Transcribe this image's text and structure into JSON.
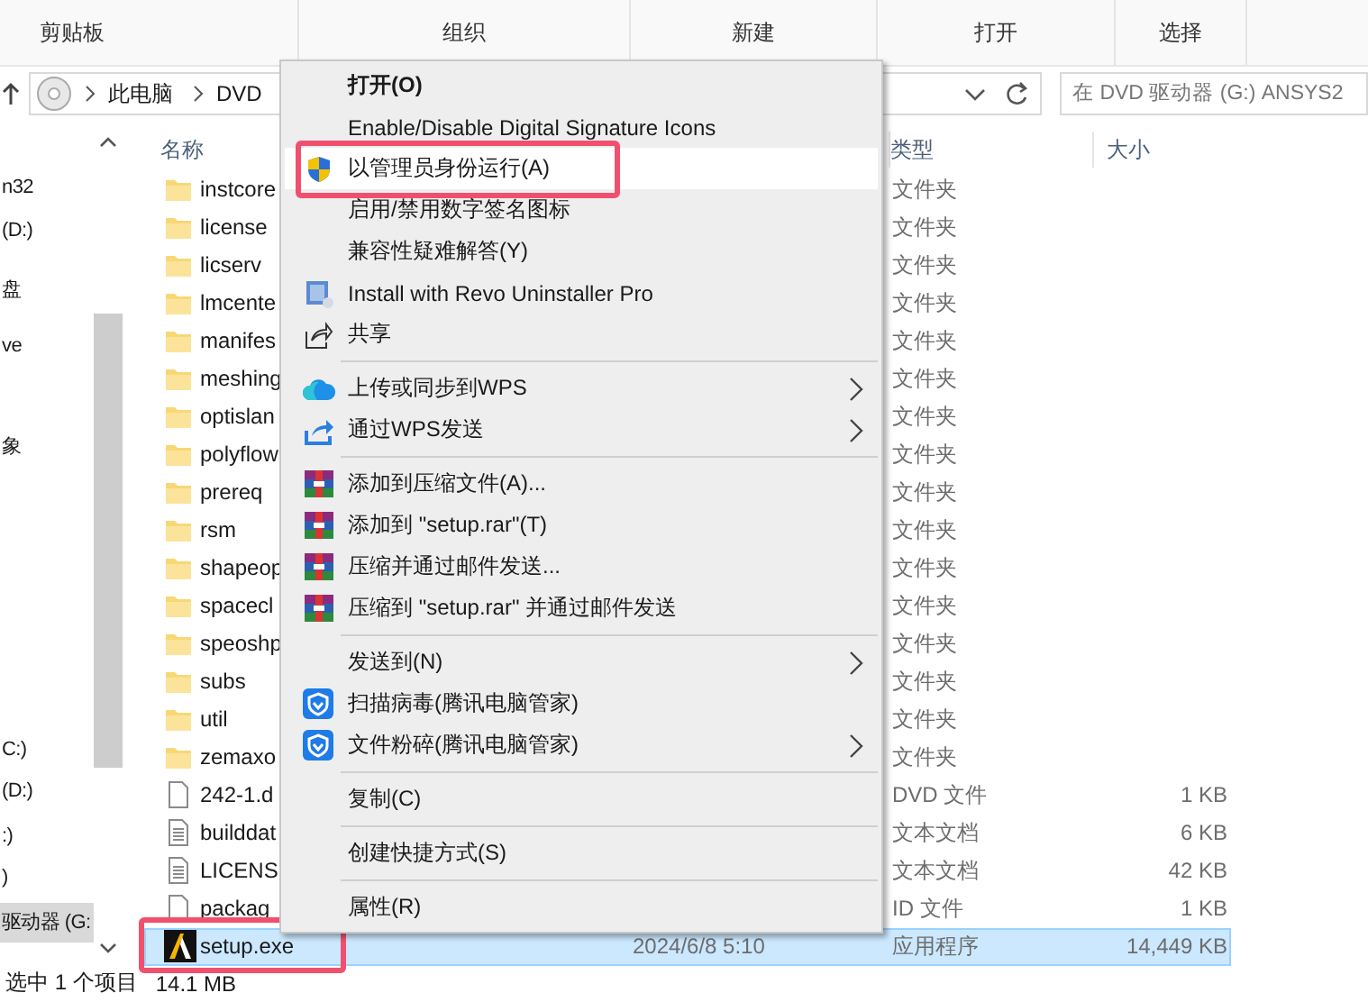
{
  "ribbon": {
    "groups": [
      "剪贴板",
      "组织",
      "新建",
      "打开",
      "选择"
    ]
  },
  "address": {
    "path": [
      "此电脑",
      "DVD"
    ],
    "search": {
      "placeholder": "在 DVD 驱动器 (G:) ANSYS2"
    }
  },
  "nav": {
    "items": [
      {
        "label": "n32",
        "selected": false
      },
      {
        "label": "(D:)",
        "selected": false
      },
      {
        "label": "盘",
        "selected": false
      },
      {
        "label": "ve",
        "selected": false
      },
      {
        "label": "象",
        "selected": false
      },
      {
        "label": "C:)",
        "selected": false
      },
      {
        "label": "(D:)",
        "selected": false
      },
      {
        "label": ":)",
        "selected": false
      },
      {
        "label": ")",
        "selected": false
      },
      {
        "label": "驱动器 (G:",
        "selected": true
      }
    ]
  },
  "file_list": {
    "columns": [
      "名称",
      "类型",
      "大小"
    ],
    "rows": [
      {
        "kind": "folder",
        "name": "instcore",
        "type": "文件夹",
        "selected": false,
        "annotated": false
      },
      {
        "kind": "folder",
        "name": "license",
        "type": "文件夹",
        "selected": false,
        "annotated": false
      },
      {
        "kind": "folder",
        "name": "licserv",
        "type": "文件夹",
        "selected": false,
        "annotated": false
      },
      {
        "kind": "folder",
        "name": "lmcente",
        "type": "文件夹",
        "selected": false,
        "annotated": false
      },
      {
        "kind": "folder",
        "name": "manifes",
        "type": "文件夹",
        "selected": false,
        "annotated": false
      },
      {
        "kind": "folder",
        "name": "meshing",
        "type": "文件夹",
        "selected": false,
        "annotated": false
      },
      {
        "kind": "folder",
        "name": "optislan",
        "type": "文件夹",
        "selected": false,
        "annotated": false
      },
      {
        "kind": "folder",
        "name": "polyflow",
        "type": "文件夹",
        "selected": false,
        "annotated": false
      },
      {
        "kind": "folder",
        "name": "prereq",
        "type": "文件夹",
        "selected": false,
        "annotated": false
      },
      {
        "kind": "folder",
        "name": "rsm",
        "type": "文件夹",
        "selected": false,
        "annotated": false
      },
      {
        "kind": "folder",
        "name": "shapeop",
        "type": "文件夹",
        "selected": false,
        "annotated": false
      },
      {
        "kind": "folder",
        "name": "spacecl",
        "type": "文件夹",
        "selected": false,
        "annotated": false
      },
      {
        "kind": "folder",
        "name": "speoshp",
        "type": "文件夹",
        "selected": false,
        "annotated": false
      },
      {
        "kind": "folder",
        "name": "subs",
        "type": "文件夹",
        "selected": false,
        "annotated": false
      },
      {
        "kind": "folder",
        "name": "util",
        "type": "文件夹",
        "selected": false,
        "annotated": false
      },
      {
        "kind": "folder",
        "name": "zemaxo",
        "type": "文件夹",
        "selected": false,
        "annotated": false
      },
      {
        "kind": "file",
        "name": "242-1.d",
        "type": "DVD 文件",
        "size": "1 KB",
        "selected": false,
        "annotated": false
      },
      {
        "kind": "text",
        "name": "builddat",
        "type": "文本文档",
        "size": "6 KB",
        "selected": false,
        "annotated": false
      },
      {
        "kind": "text",
        "name": "LICENS",
        "type": "文本文档",
        "size": "42 KB",
        "selected": false,
        "annotated": false
      },
      {
        "kind": "file",
        "name": "packag",
        "type": "ID 文件",
        "size": "1 KB",
        "selected": false,
        "annotated": false
      },
      {
        "kind": "app",
        "name": "setup.exe",
        "date": "2024/6/8 5:10",
        "type": "应用程序",
        "size": "14,449 KB",
        "selected": true,
        "annotated": true
      }
    ]
  },
  "context_menu": {
    "items": [
      {
        "kind": "item",
        "label": "打开(O)",
        "default": true,
        "selected": false,
        "annotated": false,
        "submenu": false
      },
      {
        "kind": "item",
        "label": "Enable/Disable Digital Signature Icons",
        "default": false,
        "selected": false,
        "annotated": false,
        "submenu": false
      },
      {
        "kind": "item",
        "label": "以管理员身份运行(A)",
        "default": false,
        "selected": true,
        "annotated": true,
        "submenu": false
      },
      {
        "kind": "item",
        "label": "启用/禁用数字签名图标",
        "default": false,
        "selected": false,
        "annotated": false,
        "submenu": false
      },
      {
        "kind": "item",
        "label": "兼容性疑难解答(Y)",
        "default": false,
        "selected": false,
        "annotated": false,
        "submenu": false
      },
      {
        "kind": "item",
        "label": "Install with Revo Uninstaller Pro",
        "default": false,
        "selected": false,
        "annotated": false,
        "submenu": false
      },
      {
        "kind": "item",
        "label": "共享",
        "default": false,
        "selected": false,
        "annotated": false,
        "submenu": false
      },
      {
        "kind": "separator"
      },
      {
        "kind": "item",
        "label": "上传或同步到WPS",
        "default": false,
        "selected": false,
        "annotated": false,
        "submenu": true
      },
      {
        "kind": "item",
        "label": "通过WPS发送",
        "default": false,
        "selected": false,
        "annotated": false,
        "submenu": true
      },
      {
        "kind": "separator"
      },
      {
        "kind": "item",
        "label": "添加到压缩文件(A)...",
        "default": false,
        "selected": false,
        "annotated": false,
        "submenu": false
      },
      {
        "kind": "item",
        "label": "添加到 \"setup.rar\"(T)",
        "default": false,
        "selected": false,
        "annotated": false,
        "submenu": false
      },
      {
        "kind": "item",
        "label": "压缩并通过邮件发送...",
        "default": false,
        "selected": false,
        "annotated": false,
        "submenu": false
      },
      {
        "kind": "item",
        "label": "压缩到 \"setup.rar\" 并通过邮件发送",
        "default": false,
        "selected": false,
        "annotated": false,
        "submenu": false
      },
      {
        "kind": "separator"
      },
      {
        "kind": "item",
        "label": "发送到(N)",
        "default": false,
        "selected": false,
        "annotated": false,
        "submenu": true
      },
      {
        "kind": "item",
        "label": "扫描病毒(腾讯电脑管家)",
        "default": false,
        "selected": false,
        "annotated": false,
        "submenu": false
      },
      {
        "kind": "item",
        "label": "文件粉碎(腾讯电脑管家)",
        "default": false,
        "selected": false,
        "annotated": false,
        "submenu": true
      },
      {
        "kind": "separator"
      },
      {
        "kind": "item",
        "label": "复制(C)",
        "default": false,
        "selected": false,
        "annotated": false,
        "submenu": false
      },
      {
        "kind": "separator"
      },
      {
        "kind": "item",
        "label": "创建快捷方式(S)",
        "default": false,
        "selected": false,
        "annotated": false,
        "submenu": false
      },
      {
        "kind": "separator"
      },
      {
        "kind": "item",
        "label": "属性(R)",
        "default": false,
        "selected": false,
        "annotated": false,
        "submenu": false
      }
    ]
  },
  "status_bar": {
    "selection": "选中 1 个项目",
    "size": "14.1 MB"
  }
}
